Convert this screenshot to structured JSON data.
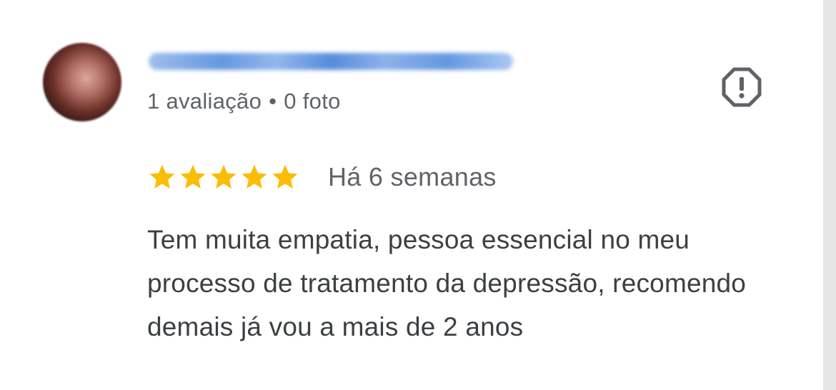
{
  "review": {
    "author_name": "Nome do usuário",
    "meta": {
      "reviews": "1 avaliação",
      "separator": "•",
      "photos": "0 foto"
    },
    "rating": 5,
    "date": "Há 6 semanas",
    "text": "Tem muita empatia, pessoa essencial no meu processo de tratamento da depressão, recomendo demais já vou a mais de 2 anos"
  },
  "colors": {
    "star": "#FBBC04",
    "secondary_text": "#5f6368",
    "body_text": "#3c4043",
    "icon": "#5f6368"
  },
  "icons": {
    "flag": "report-octagon-icon",
    "star": "star-icon"
  }
}
